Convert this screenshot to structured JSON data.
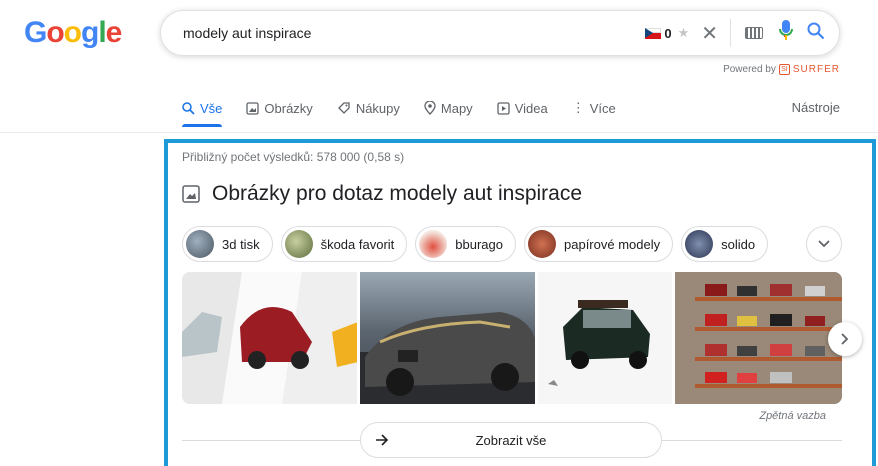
{
  "logo": {
    "letters": [
      "G",
      "o",
      "o",
      "g",
      "l",
      "e"
    ],
    "colors": [
      "#4285f4",
      "#ea4335",
      "#fbbc05",
      "#4285f4",
      "#34a853",
      "#ea4335"
    ]
  },
  "search": {
    "query": "modely aut inspirace",
    "surfer_count": "0"
  },
  "powered_by": {
    "prefix": "Powered by",
    "brand": "SURFER",
    "brand_mark": "SI"
  },
  "tabs": [
    {
      "label": "Vše",
      "icon": "search-icon",
      "active": true
    },
    {
      "label": "Obrázky",
      "icon": "image-icon"
    },
    {
      "label": "Nákupy",
      "icon": "tag-icon"
    },
    {
      "label": "Mapy",
      "icon": "map-pin-icon"
    },
    {
      "label": "Videa",
      "icon": "play-icon"
    },
    {
      "label": "Více",
      "icon": "more-vert-icon"
    }
  ],
  "tools_label": "Nástroje",
  "result_stats": "Přibližný počet výsledků: 578 000 (0,58 s)",
  "images_heading": "Obrázky pro dotaz modely aut inspirace",
  "chips": [
    {
      "label": "3d tisk",
      "color": "#6b7b8c"
    },
    {
      "label": "škoda favorit",
      "color": "#7a8a5a"
    },
    {
      "label": "bburago",
      "color": "#c0392b"
    },
    {
      "label": "papírové modely",
      "color": "#b04a3a"
    },
    {
      "label": "solido",
      "color": "#3a4a6a"
    }
  ],
  "feedback": "Zpětná vazba",
  "show_all": "Zobrazit vše",
  "accent": "#1a73e8",
  "highlight_color": "#1e9bd7"
}
